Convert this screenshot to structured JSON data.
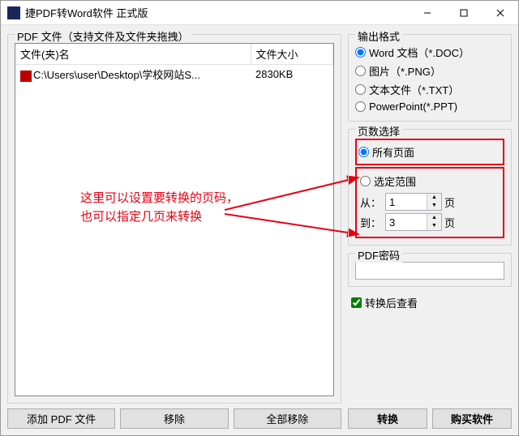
{
  "window": {
    "title": "捷PDF转Word软件 正式版"
  },
  "leftGroup": {
    "legend": "PDF 文件（支持文件及文件夹拖拽）",
    "cols": {
      "name": "文件(夹)名",
      "size": "文件大小"
    },
    "rows": [
      {
        "path": "C:\\Users\\user\\Desktop\\学校网站S...",
        "size": "2830KB"
      }
    ],
    "annotation_line1": "这里可以设置要转换的页码，",
    "annotation_line2": "也可以指定几页来转换"
  },
  "buttons": {
    "addPdf": "添加 PDF 文件",
    "remove": "移除",
    "removeAll": "全部移除",
    "convert": "转换",
    "buy": "购买软件"
  },
  "format": {
    "legend": "输出格式",
    "word": "Word 文档（*.DOC）",
    "png": "图片（*.PNG）",
    "txt": "文本文件（*.TXT）",
    "ppt": "PowerPoint(*.PPT)"
  },
  "pages": {
    "legend": "页数选择",
    "all": "所有页面",
    "range": "选定范围",
    "from": "从：",
    "fromVal": "1",
    "to": "到：",
    "toVal": "3",
    "unit": "页"
  },
  "pwd": {
    "legend": "PDF密码"
  },
  "check": {
    "label": "转换后查看"
  }
}
